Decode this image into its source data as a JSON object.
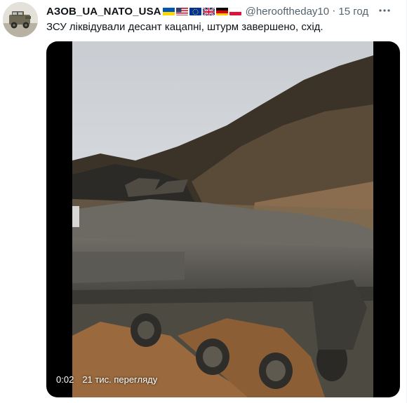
{
  "tweet": {
    "display_name": "АЗОВ_UA_NATO_USA",
    "handle": "@herooftheday10",
    "separator": "·",
    "time": "15 год",
    "text": "ЗСУ ліквідували десант кацапні, штурм завершено, схід.",
    "flags": [
      "ukraine-flag",
      "usa-flag",
      "eu-flag",
      "uk-flag",
      "germany-flag",
      "poland-flag"
    ]
  },
  "video": {
    "duration": "0:02",
    "views": "21 тис. перегляду"
  },
  "colors": {
    "text": "#0f1419",
    "secondary": "#536471",
    "media_bg": "#000000"
  }
}
